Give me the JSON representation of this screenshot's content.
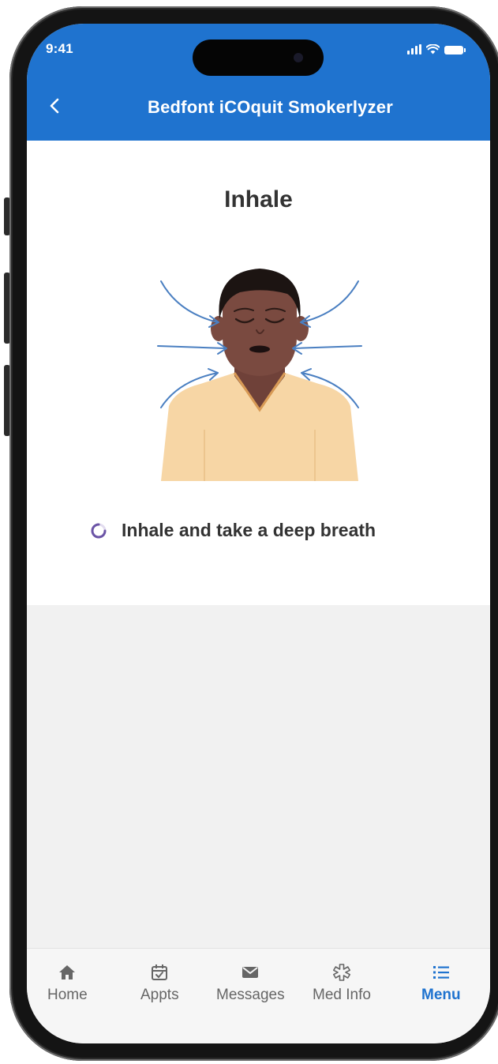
{
  "status_bar": {
    "time": "9:41"
  },
  "nav": {
    "title": "Bedfont iCOquit Smokerlyzer",
    "back_icon": "chevron-left-icon"
  },
  "step": {
    "title": "Inhale",
    "instruction": "Inhale and take a deep breath",
    "illustration": "person-inhaling-illustration"
  },
  "colors": {
    "brand_blue": "#1f73cf",
    "text_dark": "#333333",
    "tab_inactive": "#666666",
    "skin": "#7a4a40",
    "shirt": "#f7d6a5",
    "arrow_blue": "#4a7fc1"
  },
  "tabs": [
    {
      "label": "Home",
      "icon": "house-icon",
      "active": false
    },
    {
      "label": "Appts",
      "icon": "calendar-check-icon",
      "active": false
    },
    {
      "label": "Messages",
      "icon": "envelope-icon",
      "active": false
    },
    {
      "label": "Med Info",
      "icon": "medical-star-icon",
      "active": false
    },
    {
      "label": "Menu",
      "icon": "list-icon",
      "active": true
    }
  ]
}
